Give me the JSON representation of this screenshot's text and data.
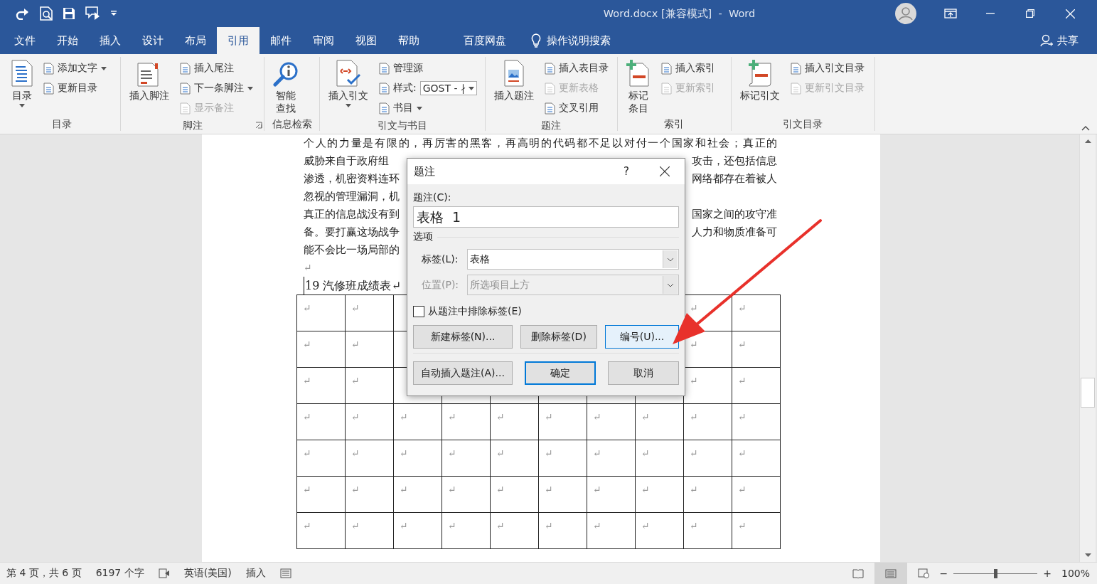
{
  "title_bar": {
    "title": "Word.docx [兼容模式]  -  Word"
  },
  "menu_tabs": [
    {
      "label": "文件",
      "selected": false
    },
    {
      "label": "开始",
      "selected": false
    },
    {
      "label": "插入",
      "selected": false
    },
    {
      "label": "设计",
      "selected": false
    },
    {
      "label": "布局",
      "selected": false
    },
    {
      "label": "引用",
      "selected": true
    },
    {
      "label": "邮件",
      "selected": false
    },
    {
      "label": "审阅",
      "selected": false
    },
    {
      "label": "视图",
      "selected": false
    },
    {
      "label": "帮助",
      "selected": false
    },
    {
      "label": "百度网盘",
      "selected": false
    }
  ],
  "tell_me": {
    "label": "操作说明搜索"
  },
  "share": {
    "label": "共享"
  },
  "ribbon": {
    "groups": [
      {
        "label": "目录",
        "large": {
          "lines": [
            "目录"
          ],
          "caret": true
        },
        "small": [
          {
            "kind": "button",
            "label": "添加文字",
            "caret": true,
            "disabled": false
          },
          {
            "kind": "button",
            "label": "更新目录",
            "caret": false,
            "disabled": false
          }
        ]
      },
      {
        "label": "脚注",
        "launcher": true,
        "large": {
          "lines": [
            "插入脚注"
          ],
          "caret": false
        },
        "small": [
          {
            "kind": "button",
            "label": "插入尾注",
            "caret": false,
            "disabled": false
          },
          {
            "kind": "button",
            "label": "下一条脚注",
            "caret": true,
            "disabled": false
          },
          {
            "kind": "button",
            "label": "显示备注",
            "caret": false,
            "disabled": true
          }
        ]
      },
      {
        "label": "信息检索",
        "large": {
          "lines": [
            "智能",
            "查找"
          ],
          "caret": false
        }
      },
      {
        "label": "引文与书目",
        "large": {
          "lines": [
            "插入引文"
          ],
          "caret": true
        },
        "small": [
          {
            "kind": "button",
            "label": "管理源",
            "caret": false,
            "disabled": false
          },
          {
            "kind": "combo",
            "label": "样式:",
            "value": "GOST - ∤",
            "caret": true,
            "disabled": false
          },
          {
            "kind": "button",
            "label": "书目",
            "caret": true,
            "disabled": false
          }
        ]
      },
      {
        "label": "题注",
        "large": {
          "lines": [
            "插入题注"
          ],
          "caret": false
        },
        "small": [
          {
            "kind": "button",
            "label": "插入表目录",
            "caret": false,
            "disabled": false
          },
          {
            "kind": "button",
            "label": "更新表格",
            "caret": false,
            "disabled": true
          },
          {
            "kind": "button",
            "label": "交叉引用",
            "caret": false,
            "disabled": false
          }
        ]
      },
      {
        "label": "索引",
        "large": {
          "lines": [
            "标记",
            "条目"
          ],
          "caret": false
        },
        "small": [
          {
            "kind": "button",
            "label": "插入索引",
            "caret": false,
            "disabled": false
          },
          {
            "kind": "button",
            "label": "更新索引",
            "caret": false,
            "disabled": true
          }
        ]
      },
      {
        "label": "引文目录",
        "large": {
          "lines": [
            "标记引文"
          ],
          "caret": false
        },
        "small": [
          {
            "kind": "button",
            "label": "插入引文目录",
            "caret": false,
            "disabled": false
          },
          {
            "kind": "button",
            "label": "更新引文目录",
            "caret": false,
            "disabled": true
          }
        ]
      }
    ]
  },
  "document": {
    "lines": [
      {
        "kind": "full",
        "left": "个人的力量是有限的，再厉害的黑客，再高明的代码都不足以对付一个国家和社会；真正的"
      },
      {
        "kind": "split",
        "left": "威胁来自于政府组",
        "right": "攻击，还包括信息"
      },
      {
        "kind": "split",
        "left": "渗透，机密资料连环",
        "right": "网络都存在着被人"
      },
      {
        "kind": "split",
        "left": "忽视的管理漏洞，机"
      },
      {
        "kind": "split",
        "left": "真正的信息战没有到",
        "right": "国家之间的攻守准"
      },
      {
        "kind": "split",
        "left": "备。要打赢这场战争",
        "right": "人力和物质准备可"
      },
      {
        "kind": "split",
        "left": "能不会比一场局部的"
      }
    ],
    "paragraph_mark": "↵",
    "caption": "19 汽修班成绩表↵",
    "table": {
      "rows": [
        {
          "left": [
            "↵",
            "↵"
          ],
          "right": [
            "↵",
            "↵"
          ]
        },
        {
          "left": [
            "↵",
            "↵"
          ],
          "right": [
            "↵",
            "↵"
          ]
        },
        {
          "left": [
            "↵",
            "↵"
          ],
          "right": [
            "↵",
            "↵"
          ]
        },
        {
          "cells": [
            "↵",
            "↵",
            "↵",
            "↵",
            "↵",
            "↵",
            "↵",
            "↵",
            "↵",
            "↵"
          ]
        },
        {
          "cells": [
            "↵",
            "↵",
            "↵",
            "↵",
            "↵",
            "↵",
            "↵",
            "↵",
            "↵",
            "↵"
          ]
        },
        {
          "cells": [
            "↵",
            "↵",
            "↵",
            "↵",
            "↵",
            "↵",
            "↵",
            "↵",
            "↵",
            "↵"
          ]
        },
        {
          "cells": [
            "↵",
            "↵",
            "↵",
            "↵",
            "↵",
            "↵",
            "↵",
            "↵",
            "↵",
            "↵"
          ]
        }
      ]
    }
  },
  "dialog": {
    "title": "题注",
    "help": "?",
    "caption_label": "题注(C):",
    "caption_value": "表格  1",
    "options_label": "选项",
    "fields": [
      {
        "label": "标签(L):",
        "value": "表格",
        "disabled": false
      },
      {
        "label": "位置(P):",
        "value": "所选项目上方",
        "disabled": true
      }
    ],
    "exclude_label": {
      "label": "从题注中排除标签(E)",
      "checked": false
    },
    "button_rows": [
      [
        {
          "label": "新建标签(N)...",
          "highlighted": false,
          "default": false
        },
        {
          "label": "删除标签(D)",
          "highlighted": false,
          "default": false
        },
        {
          "label": "编号(U)...",
          "highlighted": true,
          "default": false
        }
      ],
      [
        {
          "label": "自动插入题注(A)...",
          "highlighted": false,
          "default": false
        },
        {
          "label": "确定",
          "highlighted": false,
          "default": true
        },
        {
          "label": "取消",
          "highlighted": false,
          "default": false
        }
      ]
    ]
  },
  "status_bar": {
    "items": [
      {
        "kind": "text",
        "label": "第 4 页，共 6 页"
      },
      {
        "kind": "text",
        "label": "6197 个字"
      },
      {
        "kind": "icon"
      },
      {
        "kind": "text",
        "label": "英语(美国)"
      },
      {
        "kind": "text",
        "label": "插入"
      },
      {
        "kind": "icon"
      }
    ],
    "zoom_out": "−",
    "zoom_in": "+",
    "zoom": {
      "level": 0.5,
      "label": "100%"
    }
  }
}
